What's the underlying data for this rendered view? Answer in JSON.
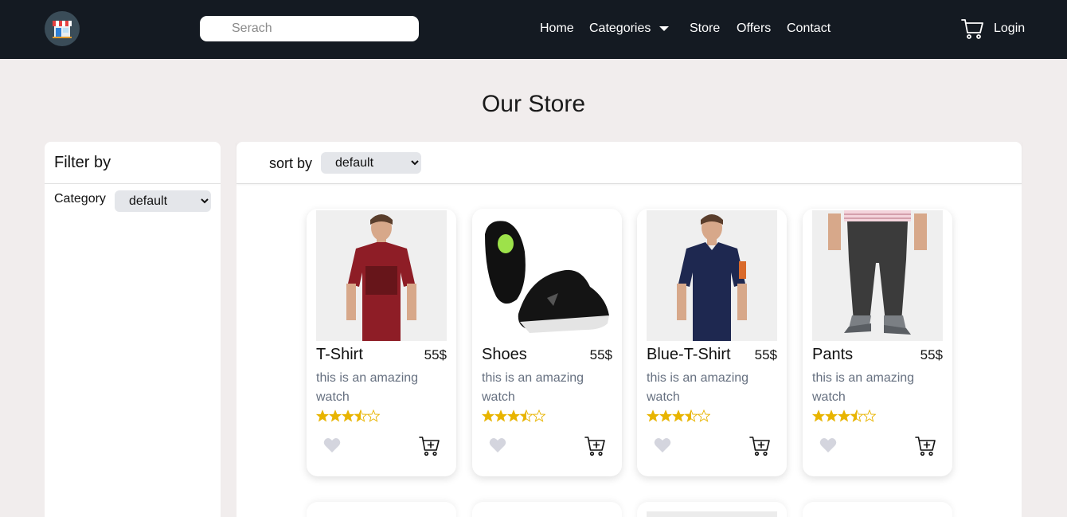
{
  "navbar": {
    "logo_icon": "store-icon",
    "search_placeholder": "Serach",
    "links": {
      "home": "Home",
      "categories": "Categories",
      "store": "Store",
      "offers": "Offers",
      "contact": "Contact"
    },
    "cart_icon": "cart-icon",
    "login": "Login"
  },
  "page": {
    "title": "Our Store"
  },
  "sidebar": {
    "title": "Filter by",
    "category_label": "Category",
    "category_selected": "default"
  },
  "main": {
    "sort_label": "sort by",
    "sort_selected": "default"
  },
  "products": [
    {
      "name": "T-Shirt",
      "price": "55$",
      "description": "this is an amazing watch",
      "rating": 3.5,
      "image": "maroon-tshirt"
    },
    {
      "name": "Shoes",
      "price": "55$",
      "description": "this is an amazing watch",
      "rating": 3.5,
      "image": "black-shoes"
    },
    {
      "name": "Blue-T-Shirt",
      "price": "55$",
      "description": "this is an amazing watch",
      "rating": 3.5,
      "image": "navy-polo"
    },
    {
      "name": "Pants",
      "price": "55$",
      "description": "this is an amazing watch",
      "rating": 3.5,
      "image": "grey-pants"
    }
  ],
  "colors": {
    "navbar_bg": "#141a22",
    "page_bg": "#f1eded",
    "star": "#e8b400",
    "heart": "#d4d5de",
    "desc_text": "#667080"
  }
}
